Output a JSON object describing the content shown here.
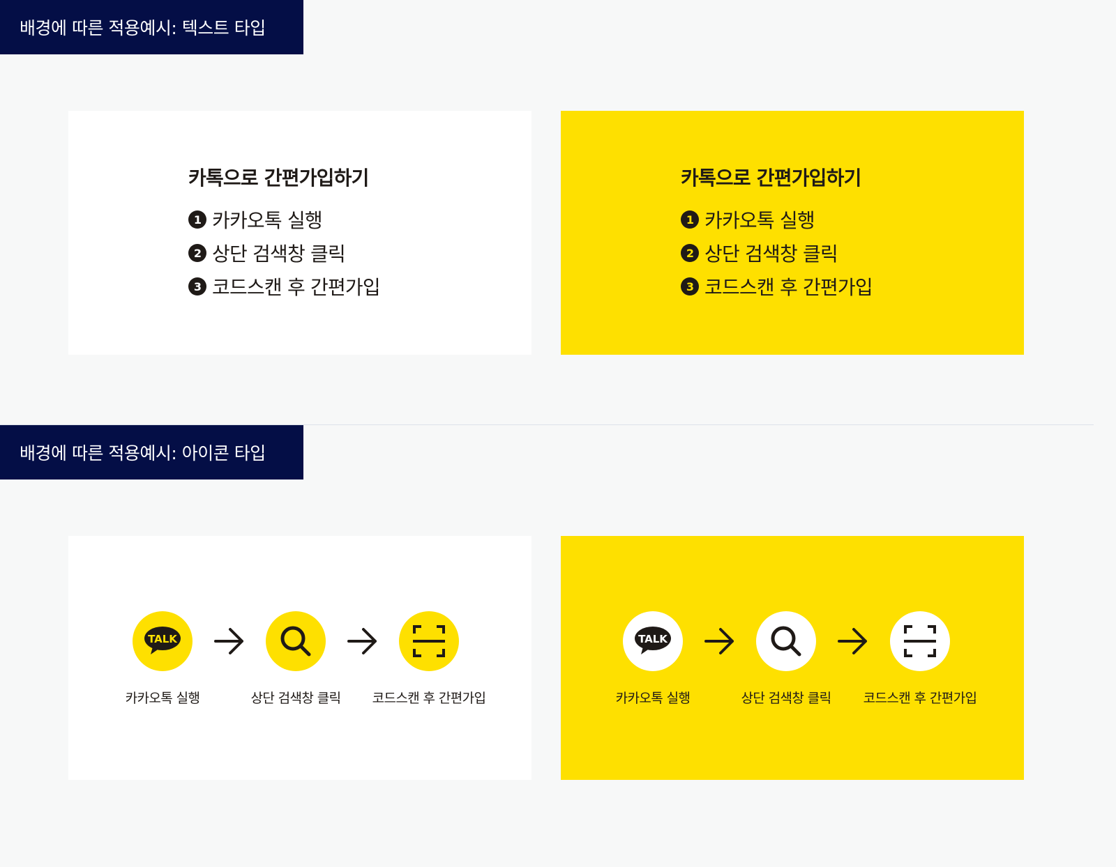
{
  "sections": {
    "text_type": {
      "label": "배경에 따른 적용예시: 텍스트 타입"
    },
    "icon_type": {
      "label": "배경에 따른 적용예시: 아이콘 타입"
    }
  },
  "text_example": {
    "title": "카톡으로 간편가입하기",
    "steps": [
      {
        "num": "1",
        "text": "카카오톡 실행"
      },
      {
        "num": "2",
        "text": "상단 검색창 클릭"
      },
      {
        "num": "3",
        "text": "코드스캔 후 간편가입"
      }
    ]
  },
  "icon_example": {
    "talk_badge": "TALK",
    "steps": [
      {
        "icon": "kakaotalk-icon",
        "label": "카카오톡 실행"
      },
      {
        "icon": "search-icon",
        "label": "상단 검색창 클릭"
      },
      {
        "icon": "scan-icon",
        "label": "코드스캔 후 간편가입"
      }
    ]
  },
  "colors": {
    "label_bg": "#040e46",
    "kakao_yellow": "#fee000",
    "dark": "#1f1a17",
    "page_bg": "#f7f8f8"
  }
}
